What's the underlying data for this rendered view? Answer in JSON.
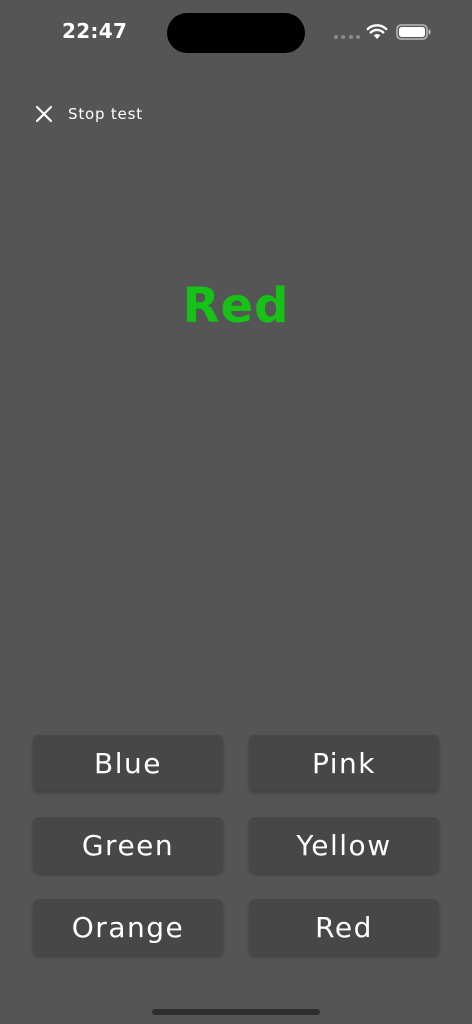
{
  "status_bar": {
    "time": "22:47"
  },
  "header": {
    "stop_label": "Stop test"
  },
  "prompt": {
    "word": "Red",
    "ink_color": "#16c216"
  },
  "answers": [
    {
      "label": "Blue"
    },
    {
      "label": "Pink"
    },
    {
      "label": "Green"
    },
    {
      "label": "Yellow"
    },
    {
      "label": "Orange"
    },
    {
      "label": "Red"
    }
  ],
  "colors": {
    "background": "#555555",
    "button": "#474747",
    "text": "#ffffff"
  }
}
